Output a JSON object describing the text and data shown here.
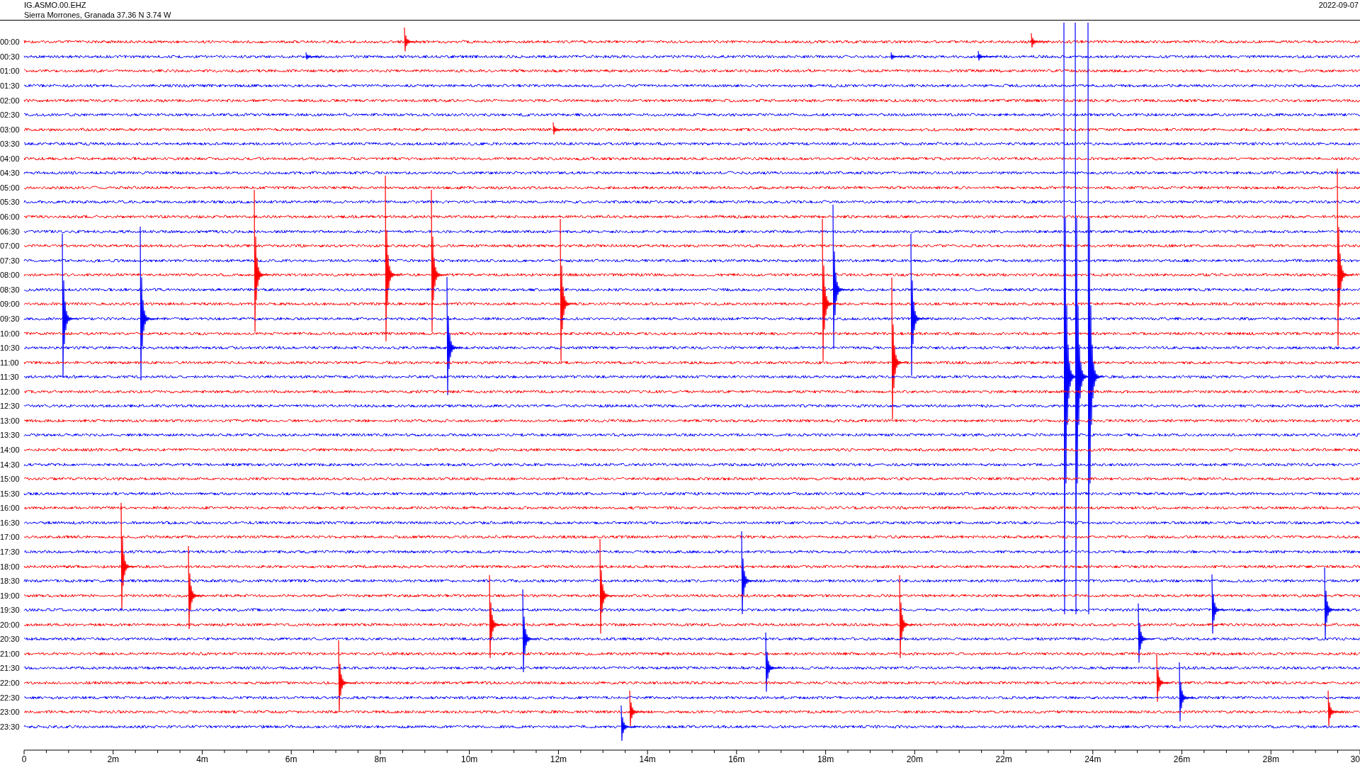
{
  "header": {
    "station": "IG.ASMO.00.EHZ",
    "location": "Sierra Morrones, Granada  37.36 N 3.74 W",
    "date": "2022-09-07"
  },
  "rows": [
    {
      "label": "00:00",
      "color": "#ff0000"
    },
    {
      "label": "00:30",
      "color": "#0000ff"
    },
    {
      "label": "01:00",
      "color": "#ff0000"
    },
    {
      "label": "01:30",
      "color": "#0000ff"
    },
    {
      "label": "02:00",
      "color": "#ff0000"
    },
    {
      "label": "02:30",
      "color": "#0000ff"
    },
    {
      "label": "03:00",
      "color": "#ff0000"
    },
    {
      "label": "03:30",
      "color": "#0000ff"
    },
    {
      "label": "04:00",
      "color": "#ff0000"
    },
    {
      "label": "04:30",
      "color": "#0000ff"
    },
    {
      "label": "05:00",
      "color": "#ff0000"
    },
    {
      "label": "05:30",
      "color": "#0000ff"
    },
    {
      "label": "06:00",
      "color": "#ff0000"
    },
    {
      "label": "06:30",
      "color": "#0000ff"
    },
    {
      "label": "07:00",
      "color": "#ff0000"
    },
    {
      "label": "07:30",
      "color": "#0000ff"
    },
    {
      "label": "08:00",
      "color": "#ff0000"
    },
    {
      "label": "08:30",
      "color": "#0000ff"
    },
    {
      "label": "09:00",
      "color": "#ff0000"
    },
    {
      "label": "09:30",
      "color": "#0000ff"
    },
    {
      "label": "10:00",
      "color": "#ff0000"
    },
    {
      "label": "10:30",
      "color": "#0000ff"
    },
    {
      "label": "11:00",
      "color": "#ff0000"
    },
    {
      "label": "11:30",
      "color": "#0000ff"
    },
    {
      "label": "12:00",
      "color": "#ff0000"
    },
    {
      "label": "12:30",
      "color": "#0000ff"
    },
    {
      "label": "13:00",
      "color": "#ff0000"
    },
    {
      "label": "13:30",
      "color": "#0000ff"
    },
    {
      "label": "14:00",
      "color": "#ff0000"
    },
    {
      "label": "14:30",
      "color": "#0000ff"
    },
    {
      "label": "15:00",
      "color": "#ff0000"
    },
    {
      "label": "15:30",
      "color": "#0000ff"
    },
    {
      "label": "16:00",
      "color": "#ff0000"
    },
    {
      "label": "16:30",
      "color": "#0000ff"
    },
    {
      "label": "17:00",
      "color": "#ff0000"
    },
    {
      "label": "17:30",
      "color": "#0000ff"
    },
    {
      "label": "18:00",
      "color": "#ff0000"
    },
    {
      "label": "18:30",
      "color": "#0000ff"
    },
    {
      "label": "19:00",
      "color": "#ff0000"
    },
    {
      "label": "19:30",
      "color": "#0000ff"
    },
    {
      "label": "20:00",
      "color": "#ff0000"
    },
    {
      "label": "20:30",
      "color": "#0000ff"
    },
    {
      "label": "21:00",
      "color": "#ff0000"
    },
    {
      "label": "21:30",
      "color": "#0000ff"
    },
    {
      "label": "22:00",
      "color": "#ff0000"
    },
    {
      "label": "22:30",
      "color": "#0000ff"
    },
    {
      "label": "23:00",
      "color": "#ff0000"
    },
    {
      "label": "23:30",
      "color": "#0000ff"
    }
  ],
  "x_axis": {
    "tick_labels": [
      "0",
      "2m",
      "4m",
      "6m",
      "8m",
      "10m",
      "12m",
      "14m",
      "16m",
      "18m",
      "20m",
      "22m",
      "24m",
      "26m",
      "28m",
      "30"
    ]
  }
}
